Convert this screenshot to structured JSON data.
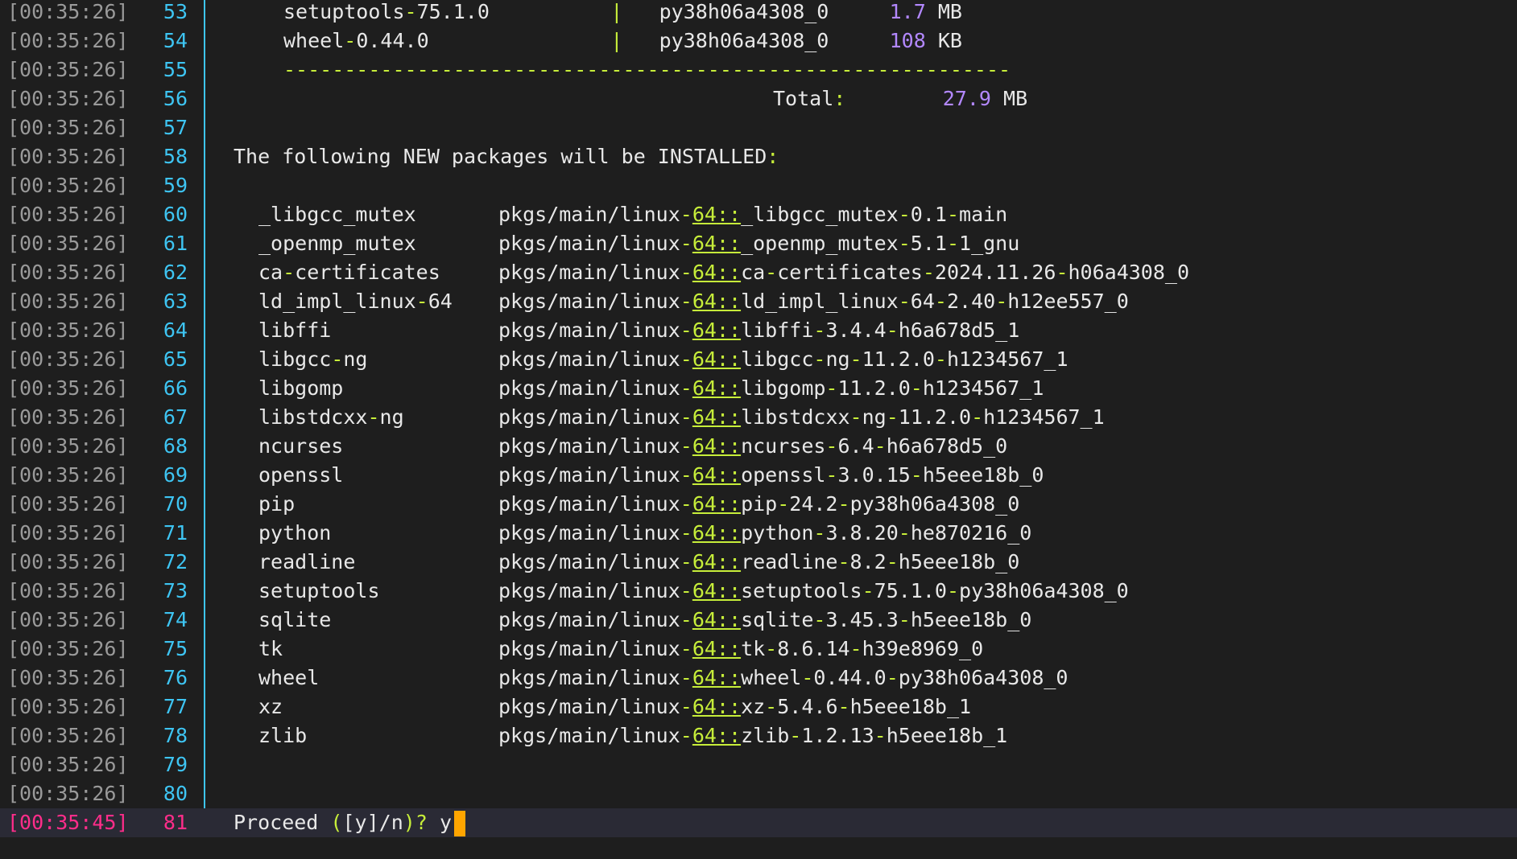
{
  "terminal": {
    "rows": [
      {
        "ts": "[00:35:26]",
        "ln": "53",
        "kind": "table",
        "a": "setuptools-75.1.0",
        "sep": "|",
        "b": "py38h06a4308_0",
        "size": "1.7",
        "unit": "MB"
      },
      {
        "ts": "[00:35:26]",
        "ln": "54",
        "kind": "table",
        "a": "wheel-0.44.0",
        "sep": "|",
        "b": "py38h06a4308_0",
        "size": "108",
        "unit": "KB"
      },
      {
        "ts": "[00:35:26]",
        "ln": "55",
        "kind": "dashes",
        "text": "------------------------------------------------------------"
      },
      {
        "ts": "[00:35:26]",
        "ln": "56",
        "kind": "total",
        "label": "Total",
        "colon": ":",
        "size": "27.9",
        "unit": "MB"
      },
      {
        "ts": "[00:35:26]",
        "ln": "57",
        "kind": "blank"
      },
      {
        "ts": "[00:35:26]",
        "ln": "58",
        "kind": "heading",
        "text": "The following NEW packages will be INSTALLED",
        "colon": ":"
      },
      {
        "ts": "[00:35:26]",
        "ln": "59",
        "kind": "blank"
      },
      {
        "ts": "[00:35:26]",
        "ln": "60",
        "kind": "pkg",
        "name": "_libgcc_mutex",
        "channel": "pkgs/main/linux",
        "arch": "64",
        "spec": "_libgcc_mutex-0.1-main"
      },
      {
        "ts": "[00:35:26]",
        "ln": "61",
        "kind": "pkg",
        "name": "_openmp_mutex",
        "channel": "pkgs/main/linux",
        "arch": "64",
        "spec": "_openmp_mutex-5.1-1_gnu"
      },
      {
        "ts": "[00:35:26]",
        "ln": "62",
        "kind": "pkg",
        "name": "ca-certificates",
        "channel": "pkgs/main/linux",
        "arch": "64",
        "spec": "ca-certificates-2024.11.26-h06a4308_0"
      },
      {
        "ts": "[00:35:26]",
        "ln": "63",
        "kind": "pkg",
        "name": "ld_impl_linux-64",
        "channel": "pkgs/main/linux",
        "arch": "64",
        "spec": "ld_impl_linux-64-2.40-h12ee557_0"
      },
      {
        "ts": "[00:35:26]",
        "ln": "64",
        "kind": "pkg",
        "name": "libffi",
        "channel": "pkgs/main/linux",
        "arch": "64",
        "spec": "libffi-3.4.4-h6a678d5_1"
      },
      {
        "ts": "[00:35:26]",
        "ln": "65",
        "kind": "pkg",
        "name": "libgcc-ng",
        "channel": "pkgs/main/linux",
        "arch": "64",
        "spec": "libgcc-ng-11.2.0-h1234567_1"
      },
      {
        "ts": "[00:35:26]",
        "ln": "66",
        "kind": "pkg",
        "name": "libgomp",
        "channel": "pkgs/main/linux",
        "arch": "64",
        "spec": "libgomp-11.2.0-h1234567_1"
      },
      {
        "ts": "[00:35:26]",
        "ln": "67",
        "kind": "pkg",
        "name": "libstdcxx-ng",
        "channel": "pkgs/main/linux",
        "arch": "64",
        "spec": "libstdcxx-ng-11.2.0-h1234567_1"
      },
      {
        "ts": "[00:35:26]",
        "ln": "68",
        "kind": "pkg",
        "name": "ncurses",
        "channel": "pkgs/main/linux",
        "arch": "64",
        "spec": "ncurses-6.4-h6a678d5_0"
      },
      {
        "ts": "[00:35:26]",
        "ln": "69",
        "kind": "pkg",
        "name": "openssl",
        "channel": "pkgs/main/linux",
        "arch": "64",
        "spec": "openssl-3.0.15-h5eee18b_0"
      },
      {
        "ts": "[00:35:26]",
        "ln": "70",
        "kind": "pkg",
        "name": "pip",
        "channel": "pkgs/main/linux",
        "arch": "64",
        "spec": "pip-24.2-py38h06a4308_0"
      },
      {
        "ts": "[00:35:26]",
        "ln": "71",
        "kind": "pkg",
        "name": "python",
        "channel": "pkgs/main/linux",
        "arch": "64",
        "spec": "python-3.8.20-he870216_0"
      },
      {
        "ts": "[00:35:26]",
        "ln": "72",
        "kind": "pkg",
        "name": "readline",
        "channel": "pkgs/main/linux",
        "arch": "64",
        "spec": "readline-8.2-h5eee18b_0"
      },
      {
        "ts": "[00:35:26]",
        "ln": "73",
        "kind": "pkg",
        "name": "setuptools",
        "channel": "pkgs/main/linux",
        "arch": "64",
        "spec": "setuptools-75.1.0-py38h06a4308_0"
      },
      {
        "ts": "[00:35:26]",
        "ln": "74",
        "kind": "pkg",
        "name": "sqlite",
        "channel": "pkgs/main/linux",
        "arch": "64",
        "spec": "sqlite-3.45.3-h5eee18b_0"
      },
      {
        "ts": "[00:35:26]",
        "ln": "75",
        "kind": "pkg",
        "name": "tk",
        "channel": "pkgs/main/linux",
        "arch": "64",
        "spec": "tk-8.6.14-h39e8969_0"
      },
      {
        "ts": "[00:35:26]",
        "ln": "76",
        "kind": "pkg",
        "name": "wheel",
        "channel": "pkgs/main/linux",
        "arch": "64",
        "spec": "wheel-0.44.0-py38h06a4308_0"
      },
      {
        "ts": "[00:35:26]",
        "ln": "77",
        "kind": "pkg",
        "name": "xz",
        "channel": "pkgs/main/linux",
        "arch": "64",
        "spec": "xz-5.4.6-h5eee18b_1"
      },
      {
        "ts": "[00:35:26]",
        "ln": "78",
        "kind": "pkg",
        "name": "zlib",
        "channel": "pkgs/main/linux",
        "arch": "64",
        "spec": "zlib-1.2.13-h5eee18b_1"
      },
      {
        "ts": "[00:35:26]",
        "ln": "79",
        "kind": "blank"
      },
      {
        "ts": "[00:35:26]",
        "ln": "80",
        "kind": "blank"
      },
      {
        "ts": "[00:35:45]",
        "ln": "81",
        "kind": "prompt",
        "text": "Proceed",
        "open": "(",
        "bracketed": "[y]",
        "slash": "/n",
        "close": ")",
        "question": "?",
        "input": "y",
        "active": true
      }
    ]
  },
  "colors": {
    "background": "#1e1e1e",
    "timestamp": "#9a9a9a",
    "line_number": "#3ec5f3",
    "active": "#ff2d8a",
    "accent_green": "#c7ee3a",
    "accent_purple": "#b388ff",
    "cursor": "#ffa500"
  }
}
